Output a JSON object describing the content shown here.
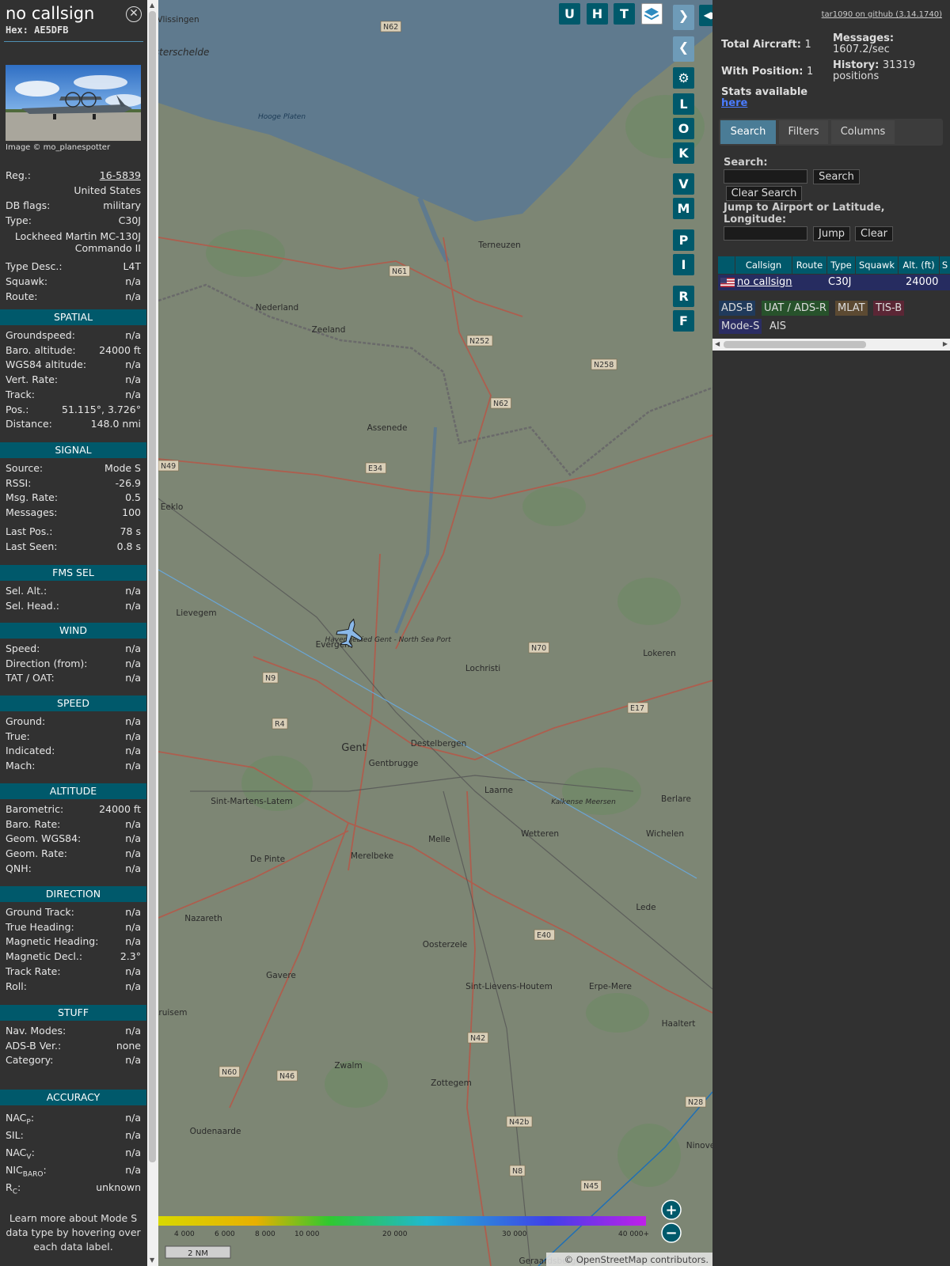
{
  "sidebar": {
    "callsign": "no callsign",
    "hex": "Hex: AE5DFB",
    "image_credit": "Image © mo_planespotter",
    "details": [
      {
        "k": "Reg.:",
        "v": "16-5839"
      },
      {
        "k": "",
        "v": "United States"
      },
      {
        "k": "DB flags:",
        "v": "military"
      },
      {
        "k": "Type:",
        "v": "C30J"
      },
      {
        "k": "",
        "v": "Lockheed Martin MC-130J Commando II"
      },
      {
        "k": "Type Desc.:",
        "v": "L4T"
      },
      {
        "k": "Squawk:",
        "v": "n/a"
      },
      {
        "k": "Route:",
        "v": "n/a"
      }
    ],
    "sections": {
      "spatial": {
        "title": "SPATIAL",
        "rows": [
          {
            "k": "Groundspeed:",
            "v": "n/a"
          },
          {
            "k": "Baro. altitude:",
            "v": "24000 ft"
          },
          {
            "k": "WGS84 altitude:",
            "v": "n/a"
          },
          {
            "k": "Vert. Rate:",
            "v": "n/a"
          },
          {
            "k": "Track:",
            "v": "n/a"
          },
          {
            "k": "Pos.:",
            "v": "51.115°, 3.726°"
          },
          {
            "k": "Distance:",
            "v": "148.0 nmi"
          }
        ]
      },
      "signal": {
        "title": "SIGNAL",
        "rows": [
          {
            "k": "Source:",
            "v": "Mode S"
          },
          {
            "k": "RSSI:",
            "v": "-26.9"
          },
          {
            "k": "Msg. Rate:",
            "v": "0.5"
          },
          {
            "k": "Messages:",
            "v": "100"
          },
          {
            "k": "Last Pos.:",
            "v": "78 s"
          },
          {
            "k": "Last Seen:",
            "v": "0.8 s"
          }
        ]
      },
      "fms": {
        "title": "FMS SEL",
        "rows": [
          {
            "k": "Sel. Alt.:",
            "v": "n/a"
          },
          {
            "k": "Sel. Head.:",
            "v": "n/a"
          }
        ]
      },
      "wind": {
        "title": "WIND",
        "rows": [
          {
            "k": "Speed:",
            "v": "n/a"
          },
          {
            "k": "Direction (from):",
            "v": "n/a"
          },
          {
            "k": "TAT / OAT:",
            "v": "n/a"
          }
        ]
      },
      "speed": {
        "title": "SPEED",
        "rows": [
          {
            "k": "Ground:",
            "v": "n/a"
          },
          {
            "k": "True:",
            "v": "n/a"
          },
          {
            "k": "Indicated:",
            "v": "n/a"
          },
          {
            "k": "Mach:",
            "v": "n/a"
          }
        ]
      },
      "altitude": {
        "title": "ALTITUDE",
        "rows": [
          {
            "k": "Barometric:",
            "v": "24000 ft"
          },
          {
            "k": "Baro. Rate:",
            "v": "n/a"
          },
          {
            "k": "Geom. WGS84:",
            "v": "n/a"
          },
          {
            "k": "Geom. Rate:",
            "v": "n/a"
          },
          {
            "k": "QNH:",
            "v": "n/a"
          }
        ]
      },
      "direction": {
        "title": "DIRECTION",
        "rows": [
          {
            "k": "Ground Track:",
            "v": "n/a"
          },
          {
            "k": "True Heading:",
            "v": "n/a"
          },
          {
            "k": "Magnetic Heading:",
            "v": "n/a"
          },
          {
            "k": "Magnetic Decl.:",
            "v": "2.3°"
          },
          {
            "k": "Track Rate:",
            "v": "n/a"
          },
          {
            "k": "Roll:",
            "v": "n/a"
          }
        ]
      },
      "stuff": {
        "title": "STUFF",
        "rows": [
          {
            "k": "Nav. Modes:",
            "v": "n/a"
          },
          {
            "k": "ADS-B Ver.:",
            "v": "none"
          },
          {
            "k": "Category:",
            "v": "n/a"
          }
        ]
      },
      "accuracy": {
        "title": "ACCURACY",
        "rows": [
          {
            "k": "NAC",
            "sub": "P",
            "v": "n/a"
          },
          {
            "k": "SIL:",
            "sub": "",
            "v": "n/a"
          },
          {
            "k": "NAC",
            "sub": "V",
            "v": "n/a"
          },
          {
            "k": "NIC",
            "sub": "BARO",
            "v": "n/a"
          },
          {
            "k": "R",
            "sub": "C",
            "v": "unknown"
          }
        ]
      }
    },
    "learn_more": "Learn more about Mode S data type by hovering over each data label."
  },
  "map": {
    "places": [
      "Vlissingen",
      "Terneuzen",
      "Nederland",
      "Zeeland",
      "Assenede",
      "Eeklo",
      "Lievegem",
      "Evergem",
      "Gent",
      "Gentbrugge",
      "Destelbergen",
      "Lochristi",
      "Lokeren",
      "Sint-Martens-Latem",
      "Laarne",
      "Berlare",
      "Wetteren",
      "Wichelen",
      "De Pinte",
      "Merelbeke",
      "Melle",
      "Nazareth",
      "Oosterzele",
      "Lede",
      "Gavere",
      "Sint-Lievens-Houtem",
      "Erpe-Mere",
      "Haaltert",
      "Zwalm",
      "Zottegem",
      "Oudenaarde",
      "Ninove",
      "Kruisem",
      "Geraardsbergen",
      "Westerschelde",
      "Hooge Platen",
      "Havengebied Gent - North Sea Port",
      "Kalkense Meersen"
    ],
    "road_labels": [
      "N62",
      "N61",
      "N252",
      "N258",
      "N62",
      "N49",
      "E34",
      "N9",
      "R4",
      "N70",
      "E17",
      "E40",
      "N42",
      "N60",
      "N46",
      "N8",
      "N42b",
      "N45",
      "N28"
    ],
    "controls": [
      "U",
      "H",
      "T",
      "L",
      "O",
      "K",
      "V",
      "M",
      "P",
      "I",
      "R",
      "F"
    ],
    "altitude_scale": [
      "4 000",
      "6 000",
      "8 000",
      "10 000",
      "20 000",
      "30 000",
      "40 000+"
    ],
    "scale_bar": "2 NM",
    "attribution": "© OpenStreetMap contributors."
  },
  "panel": {
    "github": "tar1090 on github (3.14.1740)",
    "total_aircraft_label": "Total Aircraft:",
    "total_aircraft": "1",
    "with_position_label": "With Position:",
    "with_position": "1",
    "messages_label": "Messages:",
    "messages": "1607.2/sec",
    "history_label": "History:",
    "history": "31319 positions",
    "stats_label": "Stats available",
    "stats_link": "here",
    "tabs": [
      "Search",
      "Filters",
      "Columns"
    ],
    "search_label": "Search:",
    "search_button": "Search",
    "clear_search": "Clear Search",
    "jump_label": "Jump to Airport or Latitude, Longitude:",
    "jump_button": "Jump",
    "clear_button": "Clear",
    "table": {
      "headers": [
        "Callsign",
        "Route",
        "Type",
        "Squawk",
        "Alt. (ft)",
        "S"
      ],
      "row": {
        "callsign": "no callsign",
        "route": "",
        "type": "C30J",
        "squawk": "",
        "alt": "24000"
      }
    },
    "sources": [
      {
        "label": "ADS-B",
        "color": "#203a5b"
      },
      {
        "label": "UAT / ADS-R",
        "color": "#27522b"
      },
      {
        "label": "MLAT",
        "color": "#5c4a32"
      },
      {
        "label": "TIS-B",
        "color": "#5b2635"
      },
      {
        "label": "Mode-S",
        "color": "#2b2d63"
      },
      {
        "label": "AIS",
        "color": "#313131"
      }
    ]
  }
}
